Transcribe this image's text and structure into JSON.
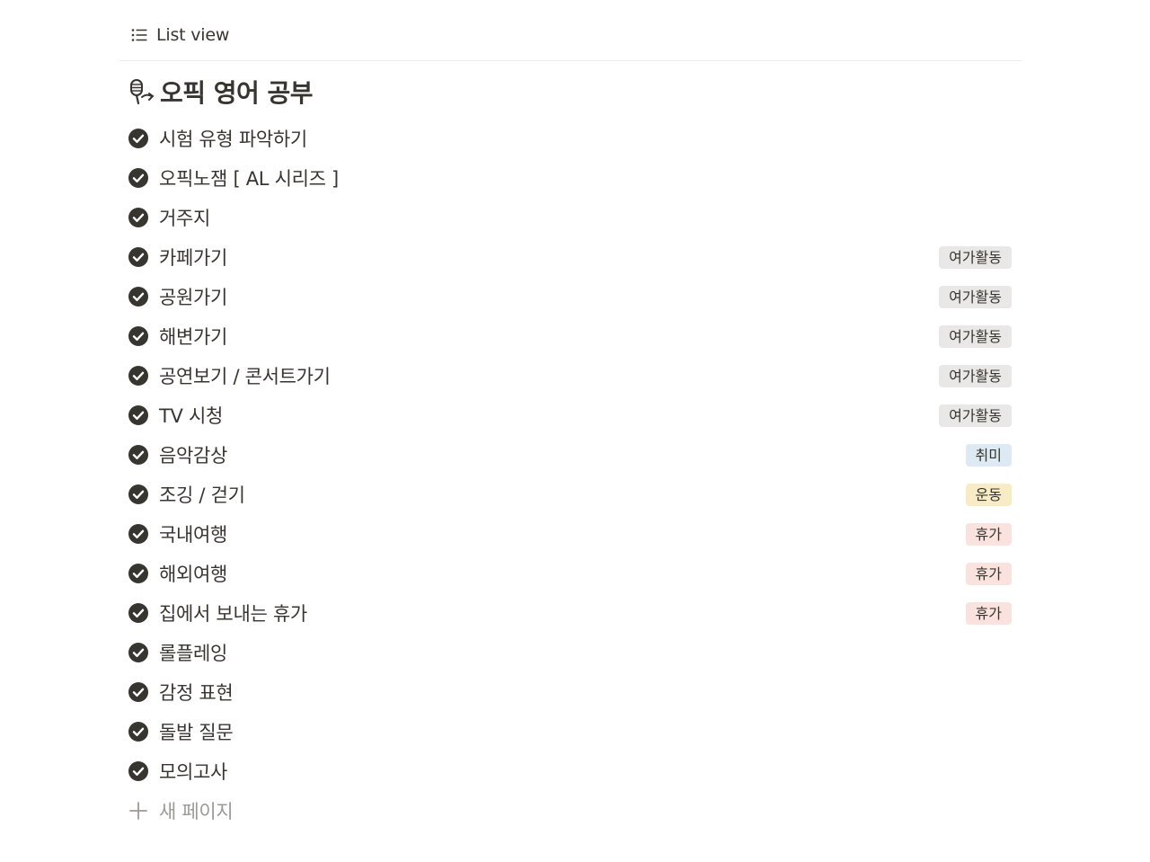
{
  "view": {
    "icon": "list-icon",
    "label": "List view"
  },
  "page": {
    "icon": "microphone-icon",
    "title": "오픽 영어 공부"
  },
  "items": [
    {
      "title": "시험 유형 파악하기",
      "tag": "",
      "tag_color": ""
    },
    {
      "title": "오픽노잼 [ AL 시리즈 ]",
      "tag": "",
      "tag_color": ""
    },
    {
      "title": "거주지",
      "tag": "",
      "tag_color": ""
    },
    {
      "title": "카페가기",
      "tag": "여가활동",
      "tag_color": "#e9e8e6"
    },
    {
      "title": "공원가기",
      "tag": "여가활동",
      "tag_color": "#e9e8e6"
    },
    {
      "title": "해변가기",
      "tag": "여가활동",
      "tag_color": "#e9e8e6"
    },
    {
      "title": "공연보기 / 콘서트가기",
      "tag": "여가활동",
      "tag_color": "#e9e8e6"
    },
    {
      "title": "TV 시청",
      "tag": "여가활동",
      "tag_color": "#e9e8e6"
    },
    {
      "title": "음악감상",
      "tag": "취미",
      "tag_color": "#dde9f3"
    },
    {
      "title": "조깅 / 걷기",
      "tag": "운동",
      "tag_color": "#f8ecc6"
    },
    {
      "title": "국내여행",
      "tag": "휴가",
      "tag_color": "#fae3df"
    },
    {
      "title": "해외여행",
      "tag": "휴가",
      "tag_color": "#fae3df"
    },
    {
      "title": "집에서 보내는 휴가",
      "tag": "휴가",
      "tag_color": "#fae3df"
    },
    {
      "title": "롤플레잉",
      "tag": "",
      "tag_color": ""
    },
    {
      "title": "감정 표현",
      "tag": "",
      "tag_color": ""
    },
    {
      "title": "돌발 질문",
      "tag": "",
      "tag_color": ""
    },
    {
      "title": "모의고사",
      "tag": "",
      "tag_color": ""
    }
  ],
  "new_page": {
    "icon": "plus-icon",
    "label": "새 페이지"
  }
}
